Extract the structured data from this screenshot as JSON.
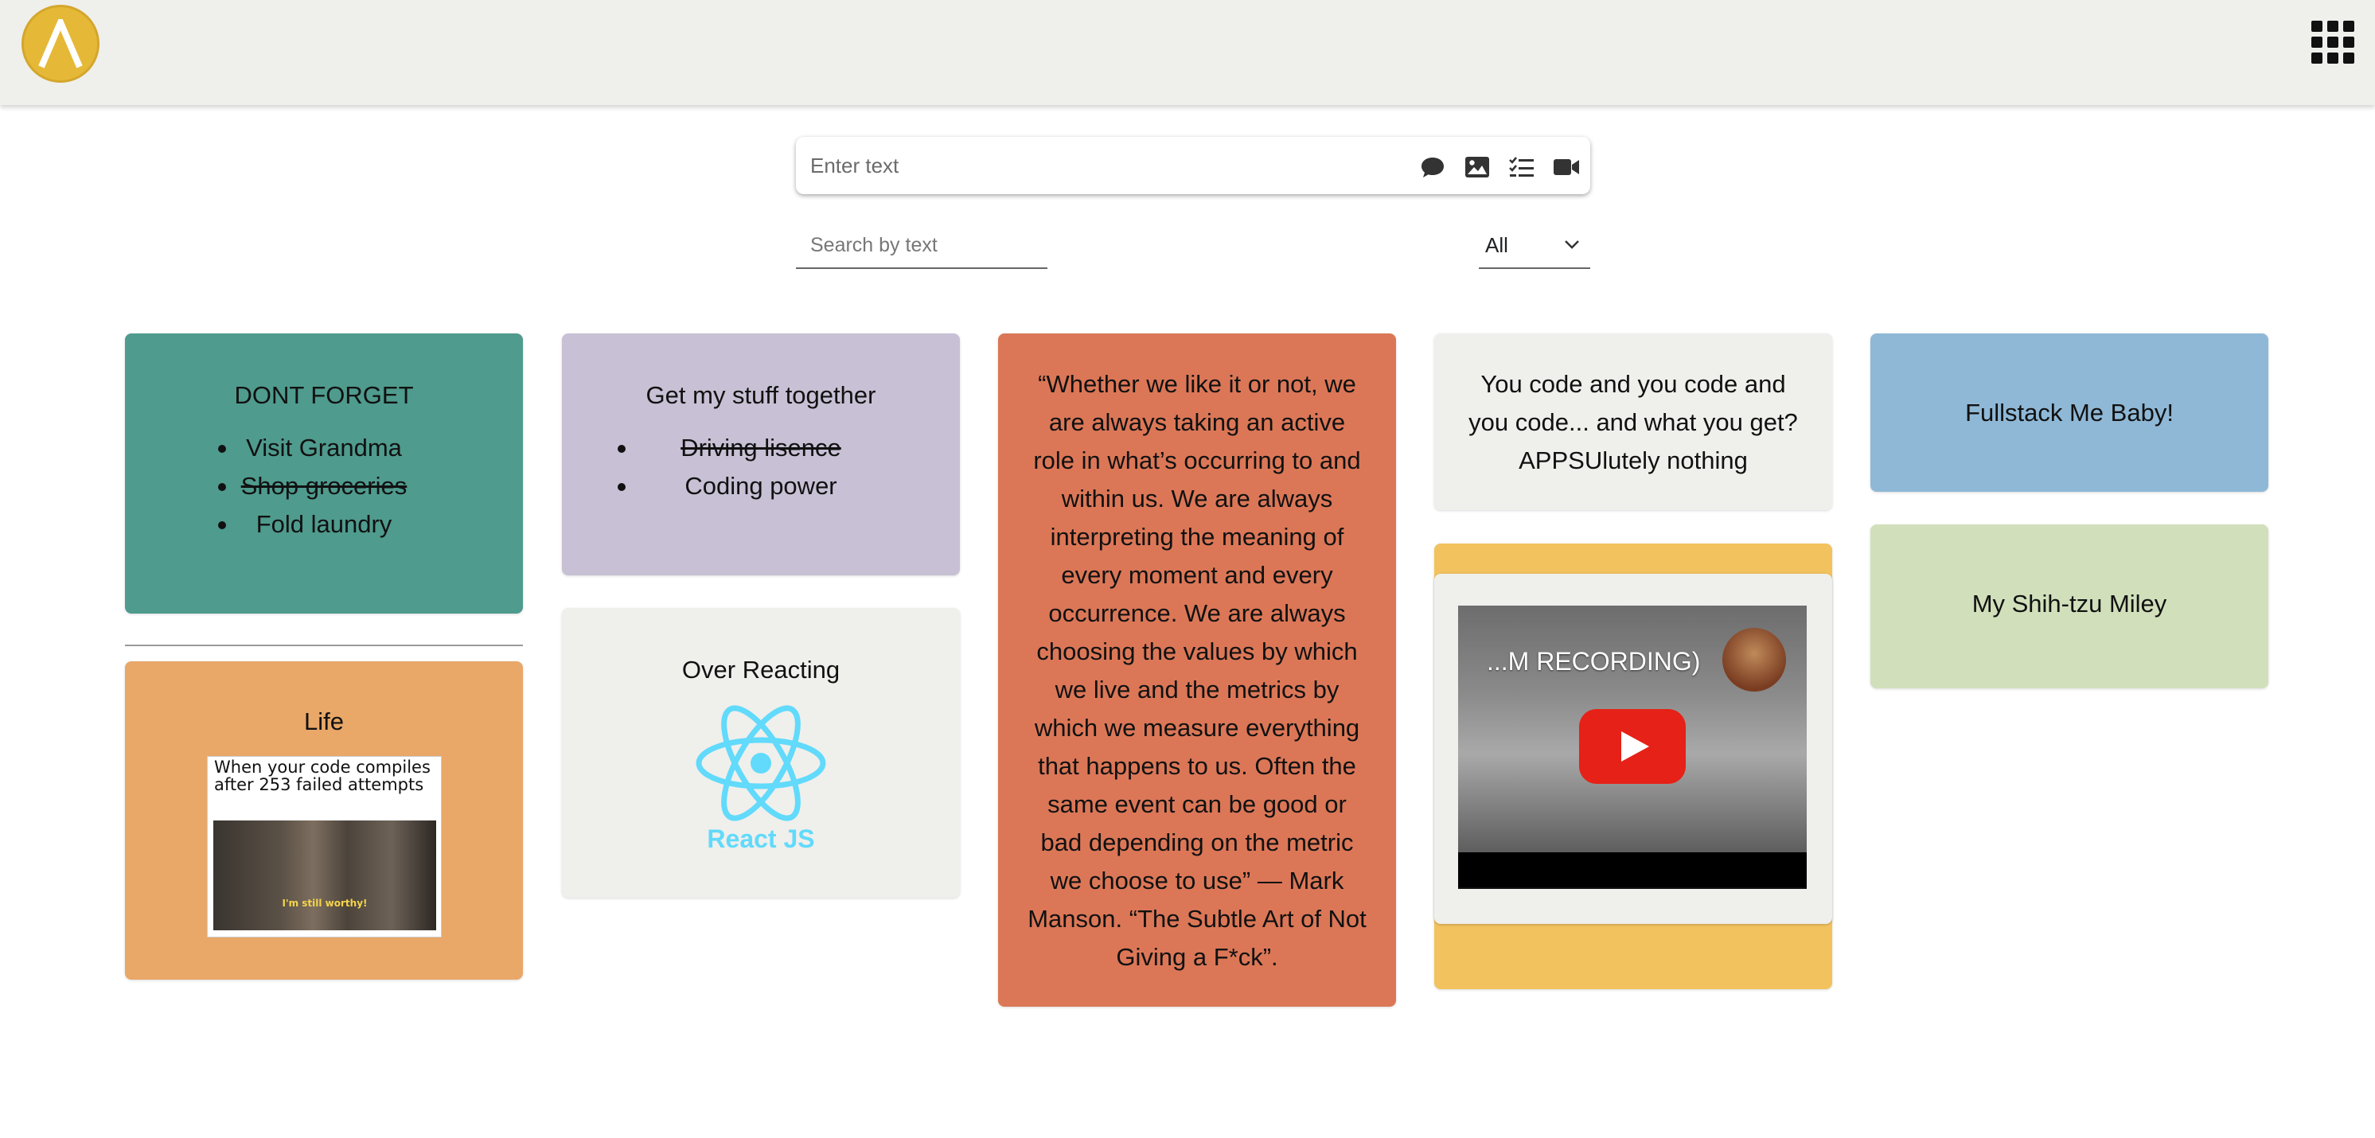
{
  "composer": {
    "placeholder": "Enter text",
    "tools": [
      "speech-bubble-icon",
      "image-icon",
      "checklist-icon",
      "video-camera-icon"
    ]
  },
  "filter": {
    "search_placeholder": "Search by text",
    "type_selected": "All"
  },
  "notes": {
    "dont_forget": {
      "title": "DONT FORGET",
      "color": "#4f9b8e",
      "todos": [
        {
          "text": "Visit Grandma",
          "done": false
        },
        {
          "text": "Shop groceries",
          "done": true
        },
        {
          "text": "Fold laundry",
          "done": false
        }
      ]
    },
    "life": {
      "title": "Life",
      "color": "#e9a768",
      "meme_caption": "When your code compiles after 253 failed attempts",
      "meme_subtitle": "I'm still worthy!"
    },
    "stuff": {
      "title": "Get my stuff together",
      "color": "#c8c0d4",
      "todos": [
        {
          "text": "Driving lisence",
          "done": true
        },
        {
          "text": "Coding power",
          "done": false
        }
      ]
    },
    "over_reacting": {
      "title": "Over Reacting",
      "color": "#efefec",
      "logo_text": "React JS",
      "logo_color": "#61dafb"
    },
    "quote": {
      "color": "#db7757",
      "text": "“Whether we like it or not, we are always taking an active role in what’s occurring to and within us. We are always interpreting the meaning of every moment and every occurrence. We are always choosing the values by which we live and the metrics by which we measure everything that happens to us. Often the same event can be good or bad depending on the metric we choose to use” — Mark Manson. “The Subtle Art of Not Giving a F*ck”."
    },
    "code": {
      "color": "#efefec",
      "text": "You code and you code and you code... and what you get? APPSUlutely nothing"
    },
    "video": {
      "color": "#f2c25e",
      "inner_color": "#efefec",
      "video_title": "...M RECORDING)"
    },
    "fullstack": {
      "color": "#8fb8d6",
      "text": "Fullstack Me Baby!"
    },
    "shihtzu": {
      "color": "#d1e0bb",
      "text": "My Shih-tzu Miley"
    }
  },
  "colors": {
    "header_bg": "#efefec",
    "logo": "#e5b937"
  }
}
